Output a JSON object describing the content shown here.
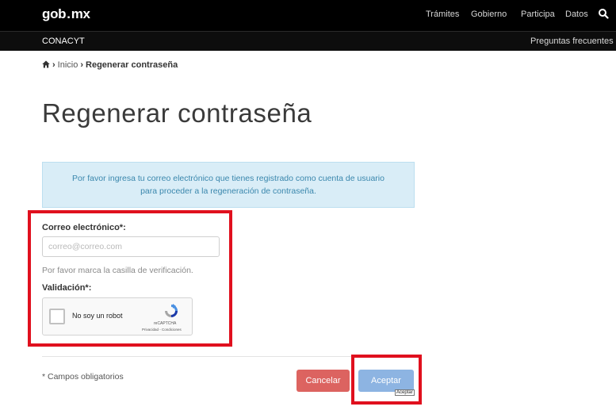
{
  "header": {
    "logo_left": "gob",
    "logo_dot": ".",
    "logo_right": "mx",
    "nav": [
      "Trámites",
      "Gobierno",
      "Participa",
      "Datos"
    ]
  },
  "subheader": {
    "brand": "CONACYT",
    "faq_link": "Preguntas frecuentes"
  },
  "breadcrumb": {
    "home_link": "Inicio",
    "separator": "›",
    "current": "Regenerar contraseña"
  },
  "page": {
    "title": "Regenerar contraseña"
  },
  "info_box": {
    "line1": "Por favor ingresa tu correo electrónico que tienes registrado como cuenta de usuario",
    "line2": "para proceder a la regeneración de contraseña."
  },
  "form": {
    "email_label": "Correo electrónico*:",
    "email_placeholder": "correo@correo.com",
    "email_value": "",
    "captcha_hint": "Por favor marca la casilla de verificación.",
    "validation_label": "Validación*:",
    "captcha": {
      "checkbox_label": "No soy un robot",
      "brand": "reCAPTCHA",
      "terms": "Privacidad - Condiciones",
      "checked": false
    },
    "required_note": "* Campos obligatorios",
    "cancel_label": "Cancelar",
    "accept_label": "Aceptar",
    "accept_tooltip": "Aceptar"
  },
  "colors": {
    "header_bg": "#000000",
    "info_bg": "#d9edf7",
    "info_text": "#3a87ad",
    "cancel_bg": "#d9534f",
    "accept_bg": "#8db4e2",
    "highlight_border": "#e0101e"
  },
  "icons": {
    "search": "search-icon",
    "home": "home-icon",
    "captcha_logo": "recaptcha-logo-icon"
  }
}
